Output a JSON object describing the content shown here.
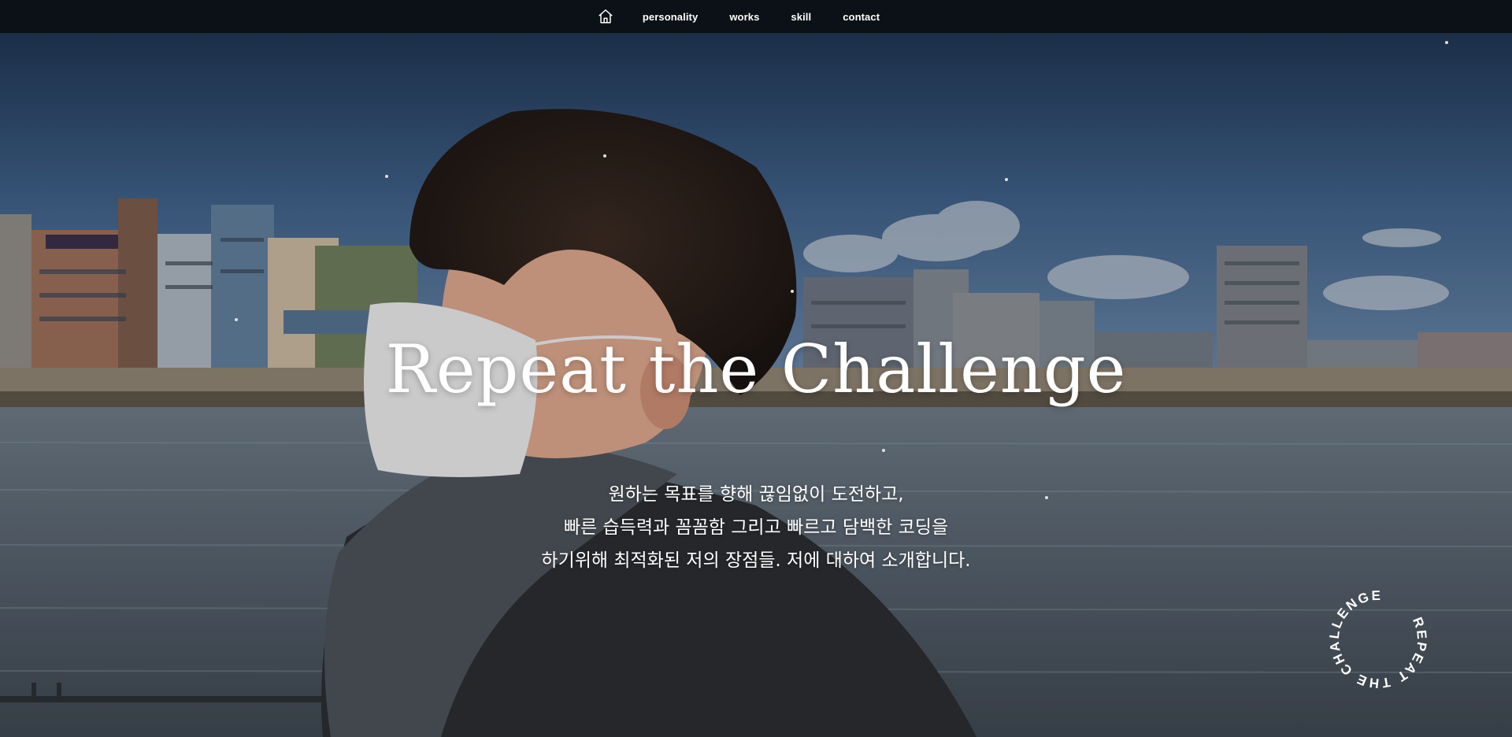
{
  "nav": {
    "home_icon": "home-icon",
    "links": [
      "personality",
      "works",
      "skill",
      "contact"
    ]
  },
  "hero": {
    "title": "Repeat the Challenge",
    "description": [
      "원하는 목표를 향해 끊임없이 도전하고,",
      "빠른 습득력과 꼼꼼함 그리고 빠르고 담백한 코딩을",
      "하기위해 최적화된 저의 장점들. 저에 대하여 소개합니다."
    ],
    "badge_text": "REPEAT THE CHALLENGE"
  },
  "colors": {
    "nav_bg": "#0c1117",
    "text": "#ffffff",
    "sky": "#3a5a80",
    "water": "#5a6a78"
  }
}
